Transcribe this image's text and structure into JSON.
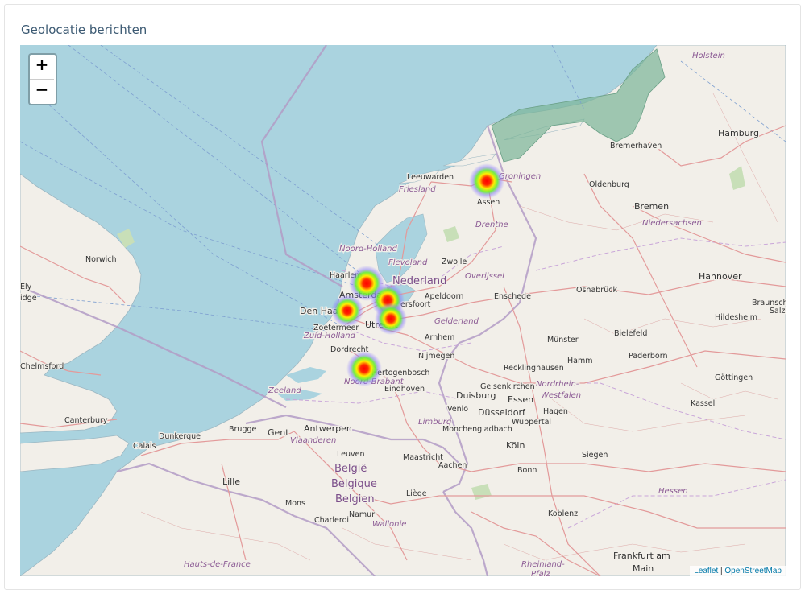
{
  "panel": {
    "title": "Geolocatie berichten"
  },
  "zoom": {
    "in_label": "+",
    "out_label": "−"
  },
  "attribution": {
    "leaflet": "Leaflet",
    "separator": " | ",
    "osm": "OpenStreetMap"
  },
  "colors": {
    "sea": "#aad3df",
    "land": "#f2efe9",
    "border": "#b39bc6",
    "road": "#e8a2a2",
    "motorway": "#e892a2",
    "park": "#c8dfb8",
    "heat_core": "#ff0000",
    "heat_mid": "#ffff00",
    "heat_outer": "#66ff33",
    "heat_halo": "#8a7cff"
  },
  "heat_points": [
    {
      "name": "Groningen"
    },
    {
      "name": "Amsterdam"
    },
    {
      "name": "Den Haag"
    },
    {
      "name": "Amersfoort"
    },
    {
      "name": "Utrecht"
    },
    {
      "name": "'s-Hertogenbosch"
    }
  ],
  "labels": {
    "holstein": "Holstein",
    "hamburg": "Hamburg",
    "bremerhaven": "Bremerhaven",
    "leeuwarden": "Leeuwarden",
    "groningen": "Groningen",
    "oldenburg": "Oldenburg",
    "friesland": "Friesland",
    "assen": "Assen",
    "bremen": "Bremen",
    "drenthe": "Drenthe",
    "niedersachsen": "Niedersachsen",
    "noord_holland": "Noord-Holland",
    "flevoland": "Flevoland",
    "zwolle": "Zwolle",
    "norwich": "Norwich",
    "haarlem": "Haarlem",
    "nederland": "Nederland",
    "overijssel": "Overijssel",
    "hannover": "Hannover",
    "ely": "Ely",
    "bridge": "idge",
    "amsterdam": "Amsterdam",
    "amersfoort": "ersfoort",
    "apeldoorn": "Apeldoorn",
    "enschede": "Enschede",
    "osnabruck": "Osnabrück",
    "braunsch": "Braunsch",
    "salz": "Salz",
    "den_haag": "Den Haa",
    "hildesheim": "Hildesheim",
    "zoetermeer": "Zoetermeer",
    "utrecht": "Utrecht",
    "gelderland": "Gelderland",
    "zuid_holland": "Zuid-Holland",
    "arnhem": "Arnhem",
    "bielefeld": "Bielefeld",
    "munster": "Münster",
    "dordrecht": "Dordrecht",
    "nijmegen": "Nijmegen",
    "paderborn": "Paderborn",
    "hamm": "Hamm",
    "chelmsford": "Chelmsford",
    "hertogenbosch": "Hertogenbosch",
    "recklinghausen": "Recklinghausen",
    "noord_brabant": "Noord-Brabant",
    "nordrhein": "Nordrhein-",
    "gottingen": "Göttingen",
    "westfalen": "Westfalen",
    "zeeland": "Zeeland",
    "eindhoven": "Eindhoven",
    "duisburg": "Duisburg",
    "essen": "Essen",
    "gelsenkirchen": "Gelsenkirchen",
    "kassel": "Kassel",
    "canterbury": "Canterbury",
    "venlo": "Venlo",
    "dusseldorf": "Düsseldorf",
    "hagen": "Hagen",
    "brugge": "Brugge",
    "limburg": "Limburg",
    "wuppertal": "Wuppertal",
    "dunkerque": "Dunkerque",
    "gent": "Gent",
    "antwerpen": "Antwerpen",
    "monchengladbach": "Monchengladbach",
    "vlaanderen": "Vlaanderen",
    "calais": "Calais",
    "koln": "Köln",
    "leuven": "Leuven",
    "maastricht": "Maastricht",
    "siegen": "Siegen",
    "belgie": "België",
    "aachen": "Aachen",
    "bonn": "Bonn",
    "belgique": "Belgique",
    "lille": "Lille",
    "liege": "Liège",
    "hessen": "Hessen",
    "mons": "Mons",
    "belgien": "Belgien",
    "namur": "Namur",
    "charleroi": "Charleroi",
    "koblenz": "Koblenz",
    "wallonie": "Wallonie",
    "hauts_de_france": "Hauts-de-France",
    "rheinland": "Rheinland-",
    "pfalz": "Pfalz",
    "frankfurt": "Frankfurt am",
    "main": "Main"
  }
}
